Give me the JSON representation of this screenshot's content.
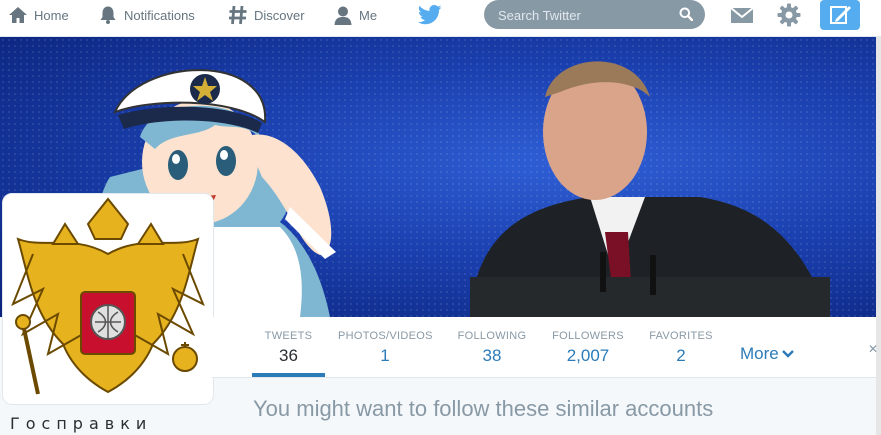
{
  "topbar": {
    "home_label": "Home",
    "notifications_label": "Notifications",
    "discover_label": "Discover",
    "me_label": "Me",
    "search_placeholder": "Search Twitter"
  },
  "profile": {
    "name": "Госправки"
  },
  "stats": [
    {
      "label": "TWEETS",
      "value": "36"
    },
    {
      "label": "PHOTOS/VIDEOS",
      "value": "1"
    },
    {
      "label": "FOLLOWING",
      "value": "38"
    },
    {
      "label": "FOLLOWERS",
      "value": "2,007"
    },
    {
      "label": "FAVORITES",
      "value": "2"
    }
  ],
  "more_label": "More",
  "suggestions_heading": "You might want to follow these similar accounts",
  "icons": {
    "home": "home-icon",
    "notifications": "bell-icon",
    "discover": "hash-icon",
    "me": "person-icon",
    "brand": "twitter-bird-icon",
    "search": "search-icon",
    "messages": "envelope-icon",
    "settings": "gear-icon",
    "compose": "compose-tweet-icon",
    "more": "chevron-down-icon"
  },
  "colors": {
    "accent": "#2b7bb9",
    "brand": "#55acee",
    "muted": "#8899a6",
    "search_bg": "#8899a6",
    "banner_blue": "#1a3fae"
  }
}
